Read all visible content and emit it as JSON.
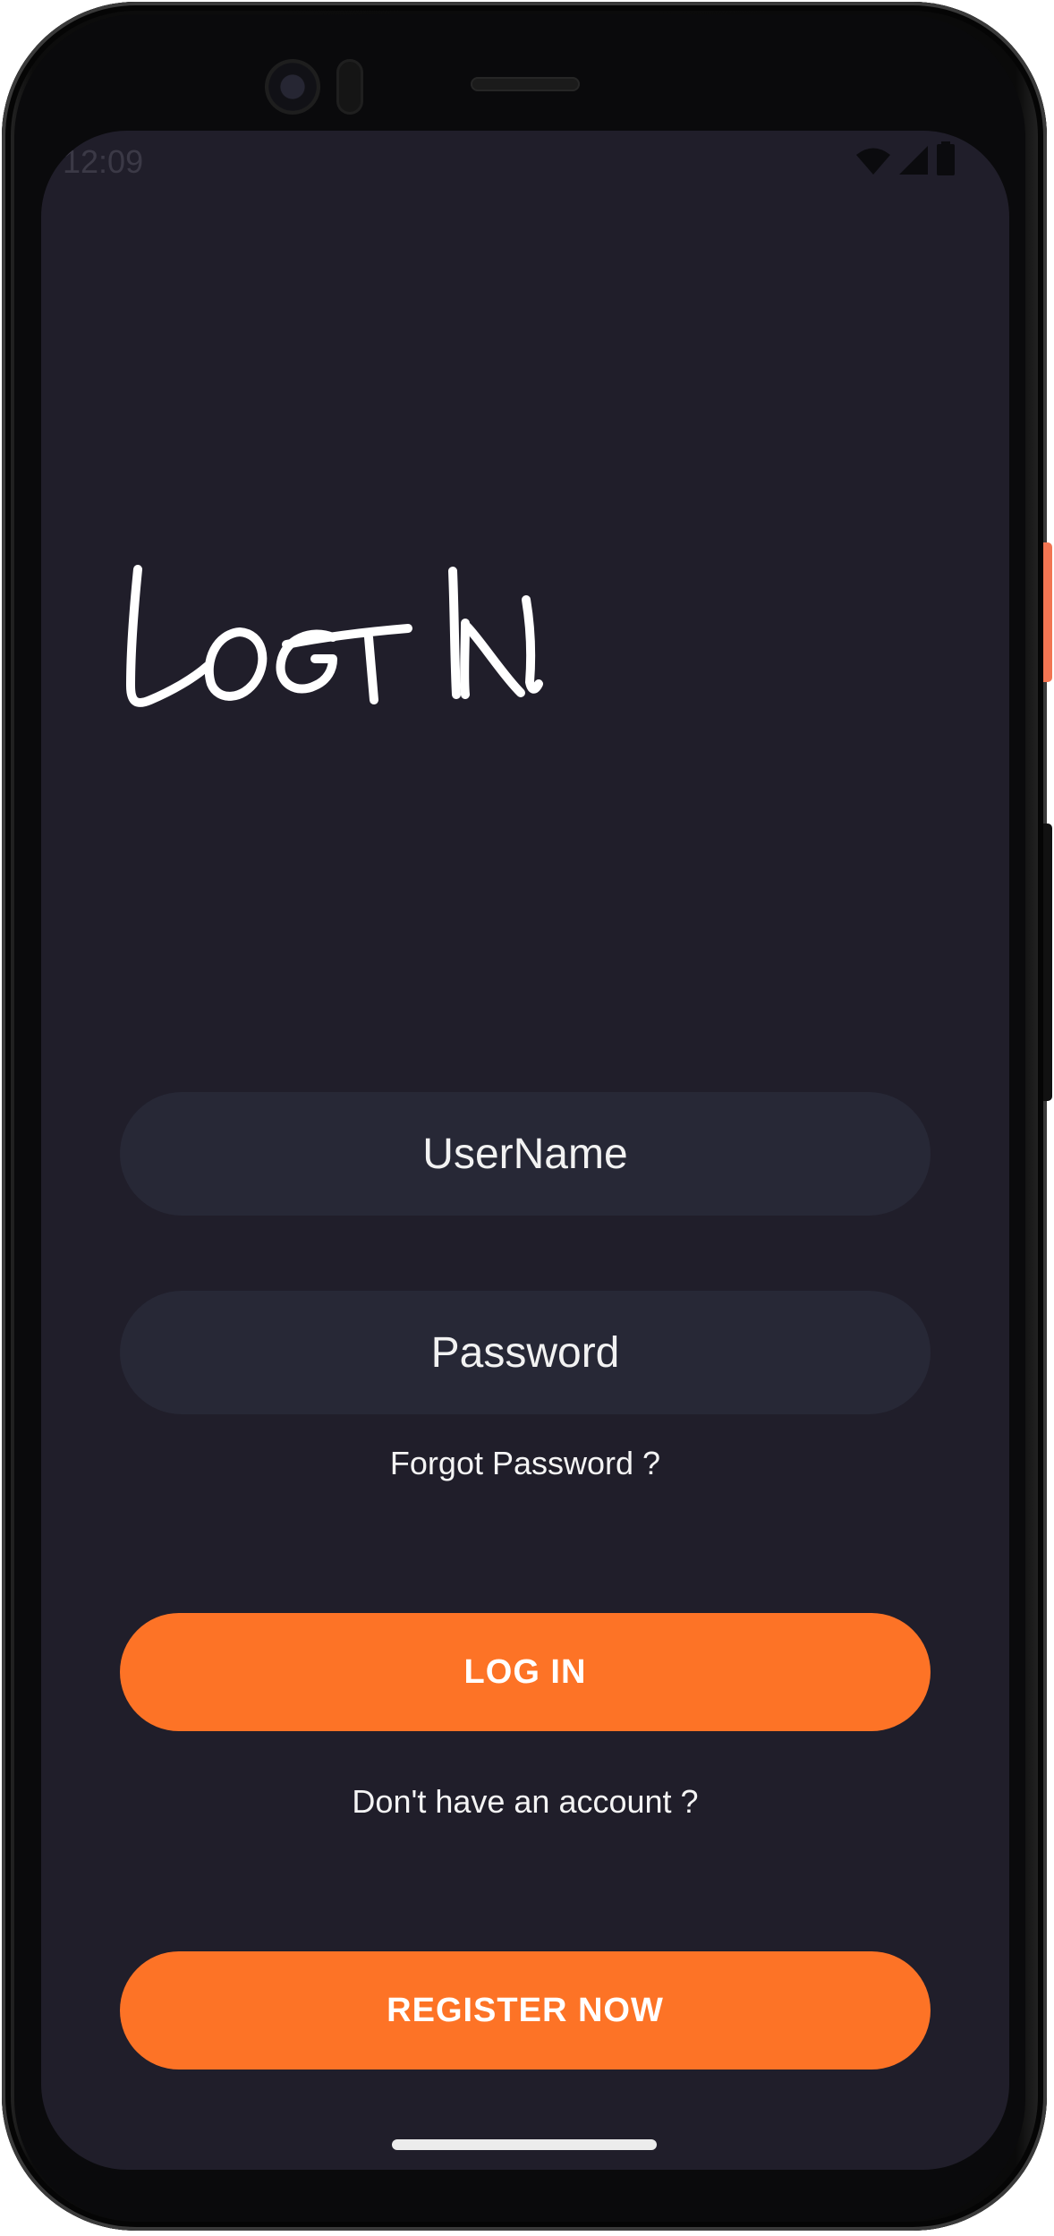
{
  "status_bar": {
    "time": "12:09",
    "icons": [
      "wifi-icon",
      "cellular-signal-icon",
      "battery-icon"
    ]
  },
  "heading": {
    "text": "LOG IN"
  },
  "form": {
    "username": {
      "value": "",
      "placeholder": "UserName"
    },
    "password": {
      "value": "",
      "placeholder": "Password"
    },
    "forgot_password": "Forgot Password ?",
    "login_button": "LOG IN",
    "no_account_text": "Don't have an account ?",
    "register_button": "REGISTER NOW"
  },
  "colors": {
    "background": "#201e2a",
    "field_background": "#272836",
    "accent": "#fd7326",
    "text": "#ffffff"
  }
}
